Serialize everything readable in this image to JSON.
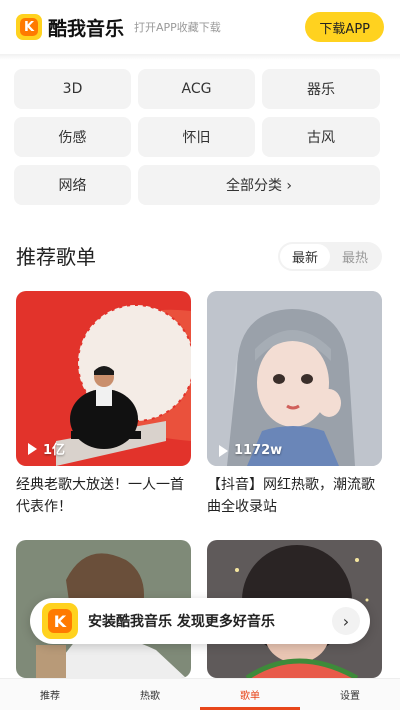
{
  "header": {
    "app_name": "酷我音乐",
    "subtitle": "打开APP收藏下载",
    "download_label": "下载APP",
    "logo_letter": "K"
  },
  "categories": [
    "3D",
    "ACG",
    "器乐",
    "伤感",
    "怀旧",
    "古风",
    "网络",
    "全部分类 ›"
  ],
  "section": {
    "title": "推荐歌单",
    "tabs": [
      "最新",
      "最热"
    ],
    "active_tab": "最新"
  },
  "playlists": [
    {
      "title": "经典老歌大放送！一人一首代表作！",
      "plays": "1亿"
    },
    {
      "title": "【抖音】网红热歌，潮流歌曲全收录站",
      "plays": "1172w"
    },
    {
      "title": "",
      "plays": ""
    },
    {
      "title": "",
      "plays": ""
    }
  ],
  "banner": {
    "text": "安装酷我音乐 发现更多好音乐",
    "arrow": "›"
  },
  "bottom_nav": [
    "推荐",
    "热歌",
    "歌单",
    "设置"
  ],
  "active_nav": "歌单",
  "colors": {
    "brand_yellow": "#ffd21f",
    "brand_orange": "#ff7a00",
    "nav_active": "#e8461a"
  }
}
